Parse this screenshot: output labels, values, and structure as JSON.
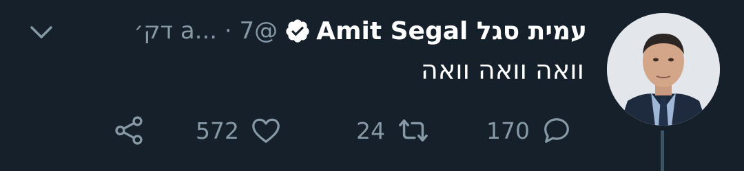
{
  "tweet": {
    "author": {
      "display_name": "עמית סגל Amit Segal",
      "verified": true,
      "handle": "@a...",
      "time": "7 דק׳"
    },
    "separator": "·",
    "text": "וואה וואה וואה",
    "stats": {
      "replies": "170",
      "retweets": "24",
      "likes": "572"
    },
    "icons": {
      "reply": "reply-icon",
      "retweet": "retweet-icon",
      "like": "heart-icon",
      "share": "share-icon",
      "menu": "chevron-down-icon",
      "verified": "verified-badge-icon"
    },
    "colors": {
      "background": "#15202b",
      "secondary_text": "#8899a6",
      "primary_text": "#ffffff",
      "thread_line": "#3d5466"
    }
  }
}
